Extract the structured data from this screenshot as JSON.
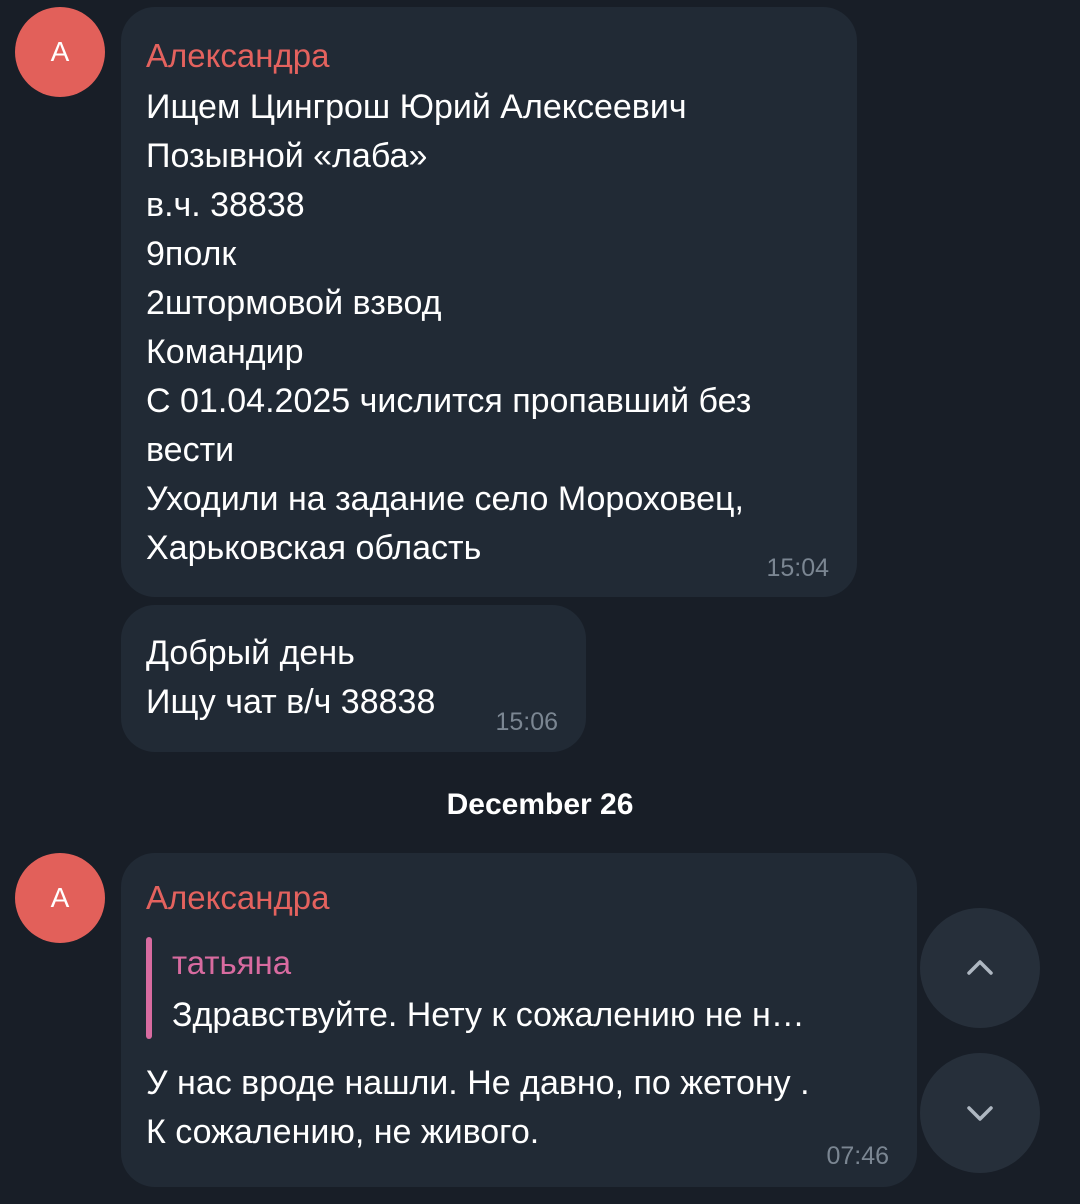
{
  "messages": [
    {
      "avatar_letter": "A",
      "sender": "Александра",
      "lines": [
        "Ищем Цингрош Юрий Алексеевич",
        "Позывной «лаба»",
        "в.ч. 38838",
        "9полк",
        "2штормовой взвод",
        "Командир",
        "С 01.04.2025 числится пропавший без",
        "вести",
        "Уходили на задание село Мороховец,",
        "Харьковская область"
      ],
      "time": "15:04"
    },
    {
      "lines": [
        "Добрый день",
        "Ищу чат в/ч 38838"
      ],
      "time": "15:06"
    },
    {
      "avatar_letter": "A",
      "sender": "Александра",
      "reply": {
        "author": "татьяна",
        "text": "Здравствуйте. Нету к сожалению не н…"
      },
      "lines": [
        "У нас вроде нашли. Не давно, по жетону .",
        "К сожалению, не живого."
      ],
      "time": "07:46"
    }
  ],
  "date_separator": "December 26",
  "icons": {
    "scroll_up": "chevron-up-icon",
    "scroll_down": "chevron-down-icon"
  },
  "colors": {
    "background": "#181e27",
    "bubble": "#212a35",
    "avatar": "#e2605a",
    "sender_name": "#e4625e",
    "quote_accent": "#d86ba0",
    "time": "#7b8692",
    "fab": "#262f3a"
  }
}
